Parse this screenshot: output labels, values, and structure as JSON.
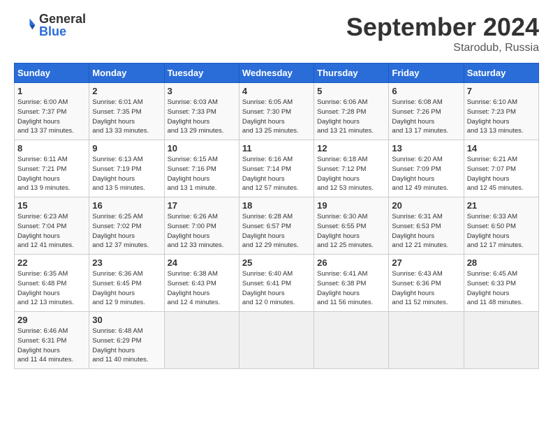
{
  "header": {
    "logo_general": "General",
    "logo_blue": "Blue",
    "month_title": "September 2024",
    "location": "Starodub, Russia"
  },
  "days_of_week": [
    "Sunday",
    "Monday",
    "Tuesday",
    "Wednesday",
    "Thursday",
    "Friday",
    "Saturday"
  ],
  "weeks": [
    [
      {
        "day": "1",
        "sunrise": "6:00 AM",
        "sunset": "7:37 PM",
        "daylight": "13 hours and 37 minutes."
      },
      {
        "day": "2",
        "sunrise": "6:01 AM",
        "sunset": "7:35 PM",
        "daylight": "13 hours and 33 minutes."
      },
      {
        "day": "3",
        "sunrise": "6:03 AM",
        "sunset": "7:33 PM",
        "daylight": "13 hours and 29 minutes."
      },
      {
        "day": "4",
        "sunrise": "6:05 AM",
        "sunset": "7:30 PM",
        "daylight": "13 hours and 25 minutes."
      },
      {
        "day": "5",
        "sunrise": "6:06 AM",
        "sunset": "7:28 PM",
        "daylight": "13 hours and 21 minutes."
      },
      {
        "day": "6",
        "sunrise": "6:08 AM",
        "sunset": "7:26 PM",
        "daylight": "13 hours and 17 minutes."
      },
      {
        "day": "7",
        "sunrise": "6:10 AM",
        "sunset": "7:23 PM",
        "daylight": "13 hours and 13 minutes."
      }
    ],
    [
      {
        "day": "8",
        "sunrise": "6:11 AM",
        "sunset": "7:21 PM",
        "daylight": "13 hours and 9 minutes."
      },
      {
        "day": "9",
        "sunrise": "6:13 AM",
        "sunset": "7:19 PM",
        "daylight": "13 hours and 5 minutes."
      },
      {
        "day": "10",
        "sunrise": "6:15 AM",
        "sunset": "7:16 PM",
        "daylight": "13 hours and 1 minute."
      },
      {
        "day": "11",
        "sunrise": "6:16 AM",
        "sunset": "7:14 PM",
        "daylight": "12 hours and 57 minutes."
      },
      {
        "day": "12",
        "sunrise": "6:18 AM",
        "sunset": "7:12 PM",
        "daylight": "12 hours and 53 minutes."
      },
      {
        "day": "13",
        "sunrise": "6:20 AM",
        "sunset": "7:09 PM",
        "daylight": "12 hours and 49 minutes."
      },
      {
        "day": "14",
        "sunrise": "6:21 AM",
        "sunset": "7:07 PM",
        "daylight": "12 hours and 45 minutes."
      }
    ],
    [
      {
        "day": "15",
        "sunrise": "6:23 AM",
        "sunset": "7:04 PM",
        "daylight": "12 hours and 41 minutes."
      },
      {
        "day": "16",
        "sunrise": "6:25 AM",
        "sunset": "7:02 PM",
        "daylight": "12 hours and 37 minutes."
      },
      {
        "day": "17",
        "sunrise": "6:26 AM",
        "sunset": "7:00 PM",
        "daylight": "12 hours and 33 minutes."
      },
      {
        "day": "18",
        "sunrise": "6:28 AM",
        "sunset": "6:57 PM",
        "daylight": "12 hours and 29 minutes."
      },
      {
        "day": "19",
        "sunrise": "6:30 AM",
        "sunset": "6:55 PM",
        "daylight": "12 hours and 25 minutes."
      },
      {
        "day": "20",
        "sunrise": "6:31 AM",
        "sunset": "6:53 PM",
        "daylight": "12 hours and 21 minutes."
      },
      {
        "day": "21",
        "sunrise": "6:33 AM",
        "sunset": "6:50 PM",
        "daylight": "12 hours and 17 minutes."
      }
    ],
    [
      {
        "day": "22",
        "sunrise": "6:35 AM",
        "sunset": "6:48 PM",
        "daylight": "12 hours and 13 minutes."
      },
      {
        "day": "23",
        "sunrise": "6:36 AM",
        "sunset": "6:45 PM",
        "daylight": "12 hours and 9 minutes."
      },
      {
        "day": "24",
        "sunrise": "6:38 AM",
        "sunset": "6:43 PM",
        "daylight": "12 hours and 4 minutes."
      },
      {
        "day": "25",
        "sunrise": "6:40 AM",
        "sunset": "6:41 PM",
        "daylight": "12 hours and 0 minutes."
      },
      {
        "day": "26",
        "sunrise": "6:41 AM",
        "sunset": "6:38 PM",
        "daylight": "11 hours and 56 minutes."
      },
      {
        "day": "27",
        "sunrise": "6:43 AM",
        "sunset": "6:36 PM",
        "daylight": "11 hours and 52 minutes."
      },
      {
        "day": "28",
        "sunrise": "6:45 AM",
        "sunset": "6:33 PM",
        "daylight": "11 hours and 48 minutes."
      }
    ],
    [
      {
        "day": "29",
        "sunrise": "6:46 AM",
        "sunset": "6:31 PM",
        "daylight": "11 hours and 44 minutes."
      },
      {
        "day": "30",
        "sunrise": "6:48 AM",
        "sunset": "6:29 PM",
        "daylight": "11 hours and 40 minutes."
      },
      null,
      null,
      null,
      null,
      null
    ]
  ]
}
